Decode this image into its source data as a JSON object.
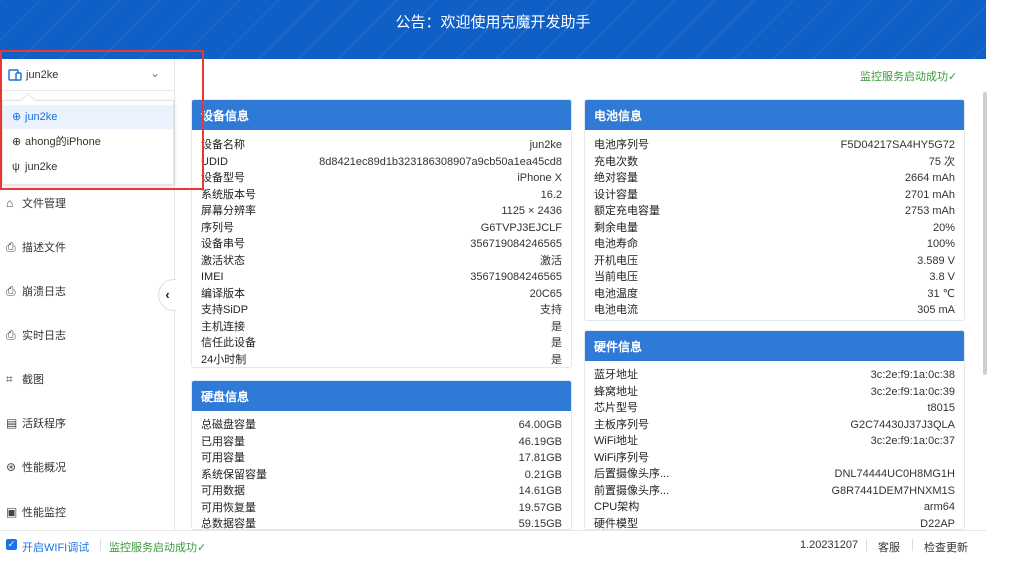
{
  "banner": {
    "text": "公告：欢迎使用克魔开发助手"
  },
  "device_selector": {
    "selected": "jun2ke"
  },
  "dropdown": [
    {
      "label": "jun2ke",
      "icon": "globe-icon",
      "glyph": "⊕",
      "selected": true
    },
    {
      "label": "ahong的iPhone",
      "icon": "globe-icon",
      "glyph": "⊕",
      "selected": false
    },
    {
      "label": "jun2ke",
      "icon": "usb-icon",
      "glyph": "ψ",
      "selected": false
    }
  ],
  "nav": [
    {
      "label": "文件管理",
      "icon": "folder-icon",
      "glyph": "⌂"
    },
    {
      "label": "描述文件",
      "icon": "profile-icon",
      "glyph": "⎙"
    },
    {
      "label": "崩溃日志",
      "icon": "crash-log-icon",
      "glyph": "⎙"
    },
    {
      "label": "实时日志",
      "icon": "realtime-log-icon",
      "glyph": "⎙"
    },
    {
      "label": "截图",
      "icon": "screenshot-icon",
      "glyph": "⌗"
    },
    {
      "label": "活跃程序",
      "icon": "app-list-icon",
      "glyph": "▤"
    },
    {
      "label": "性能概况",
      "icon": "performance-icon",
      "glyph": "⊛"
    },
    {
      "label": "性能监控",
      "icon": "monitor-icon",
      "glyph": "▣"
    }
  ],
  "monitor_status": "监控服务启动成功✓",
  "device_info": {
    "title": "设备信息",
    "rows": [
      {
        "k": "设备名称",
        "v": "jun2ke"
      },
      {
        "k": "UDID",
        "v": "8d8421ec89d1b323186308907a9cb50a1ea45cd8"
      },
      {
        "k": "设备型号",
        "v": "iPhone X"
      },
      {
        "k": "系统版本号",
        "v": "16.2"
      },
      {
        "k": "屏幕分辨率",
        "v": "1125 × 2436"
      },
      {
        "k": "序列号",
        "v": "G6TVPJ3EJCLF"
      },
      {
        "k": "设备串号",
        "v": "356719084246565"
      },
      {
        "k": "激活状态",
        "v": "激活"
      },
      {
        "k": "IMEI",
        "v": "356719084246565"
      },
      {
        "k": "编译版本",
        "v": "20C65"
      },
      {
        "k": "支持SiDP",
        "v": "支持"
      },
      {
        "k": "主机连接",
        "v": "是"
      },
      {
        "k": "信任此设备",
        "v": "是"
      },
      {
        "k": "24小时制",
        "v": "是"
      }
    ]
  },
  "disk_info": {
    "title": "硬盘信息",
    "rows": [
      {
        "k": "总磁盘容量",
        "v": "64.00GB"
      },
      {
        "k": "已用容量",
        "v": "46.19GB"
      },
      {
        "k": "可用容量",
        "v": "17.81GB"
      },
      {
        "k": "系统保留容量",
        "v": "0.21GB"
      },
      {
        "k": "可用数据",
        "v": "14.61GB"
      },
      {
        "k": "可用恢复量",
        "v": "19.57GB"
      },
      {
        "k": "总数据容量",
        "v": "59.15GB"
      }
    ]
  },
  "battery_info": {
    "title": "电池信息",
    "rows": [
      {
        "k": "电池序列号",
        "v": "F5D04217SA4HY5G72"
      },
      {
        "k": "充电次数",
        "v": "75 次"
      },
      {
        "k": "绝对容量",
        "v": "2664 mAh"
      },
      {
        "k": "设计容量",
        "v": "2701 mAh"
      },
      {
        "k": "额定充电容量",
        "v": "2753 mAh"
      },
      {
        "k": "剩余电量",
        "v": "20%"
      },
      {
        "k": "电池寿命",
        "v": "100%"
      },
      {
        "k": "开机电压",
        "v": "3.589 V"
      },
      {
        "k": "当前电压",
        "v": "3.8 V"
      },
      {
        "k": "电池温度",
        "v": "31 ℃"
      },
      {
        "k": "电池电流",
        "v": "305 mA"
      }
    ]
  },
  "hardware_info": {
    "title": "硬件信息",
    "rows": [
      {
        "k": "蓝牙地址",
        "v": "3c:2e:f9:1a:0c:38"
      },
      {
        "k": "蜂窝地址",
        "v": "3c:2e:f9:1a:0c:39"
      },
      {
        "k": "芯片型号",
        "v": "t8015"
      },
      {
        "k": "主板序列号",
        "v": "G2C74430J37J3QLA"
      },
      {
        "k": "WiFi地址",
        "v": "3c:2e:f9:1a:0c:37"
      },
      {
        "k": "WiFi序列号",
        "v": ""
      },
      {
        "k": "后置摄像头序...",
        "v": "DNL74444UC0H8MG1H"
      },
      {
        "k": "前置摄像头序...",
        "v": "G8R7441DEM7HNXM1S"
      },
      {
        "k": "CPU架构",
        "v": "arm64"
      },
      {
        "k": "硬件模型",
        "v": "D22AP"
      }
    ]
  },
  "footer": {
    "wifi_debug": "开启WIFI调试",
    "status": "监控服务启动成功✓",
    "version": "1.20231207",
    "service": "客服",
    "update": "检查更新"
  }
}
